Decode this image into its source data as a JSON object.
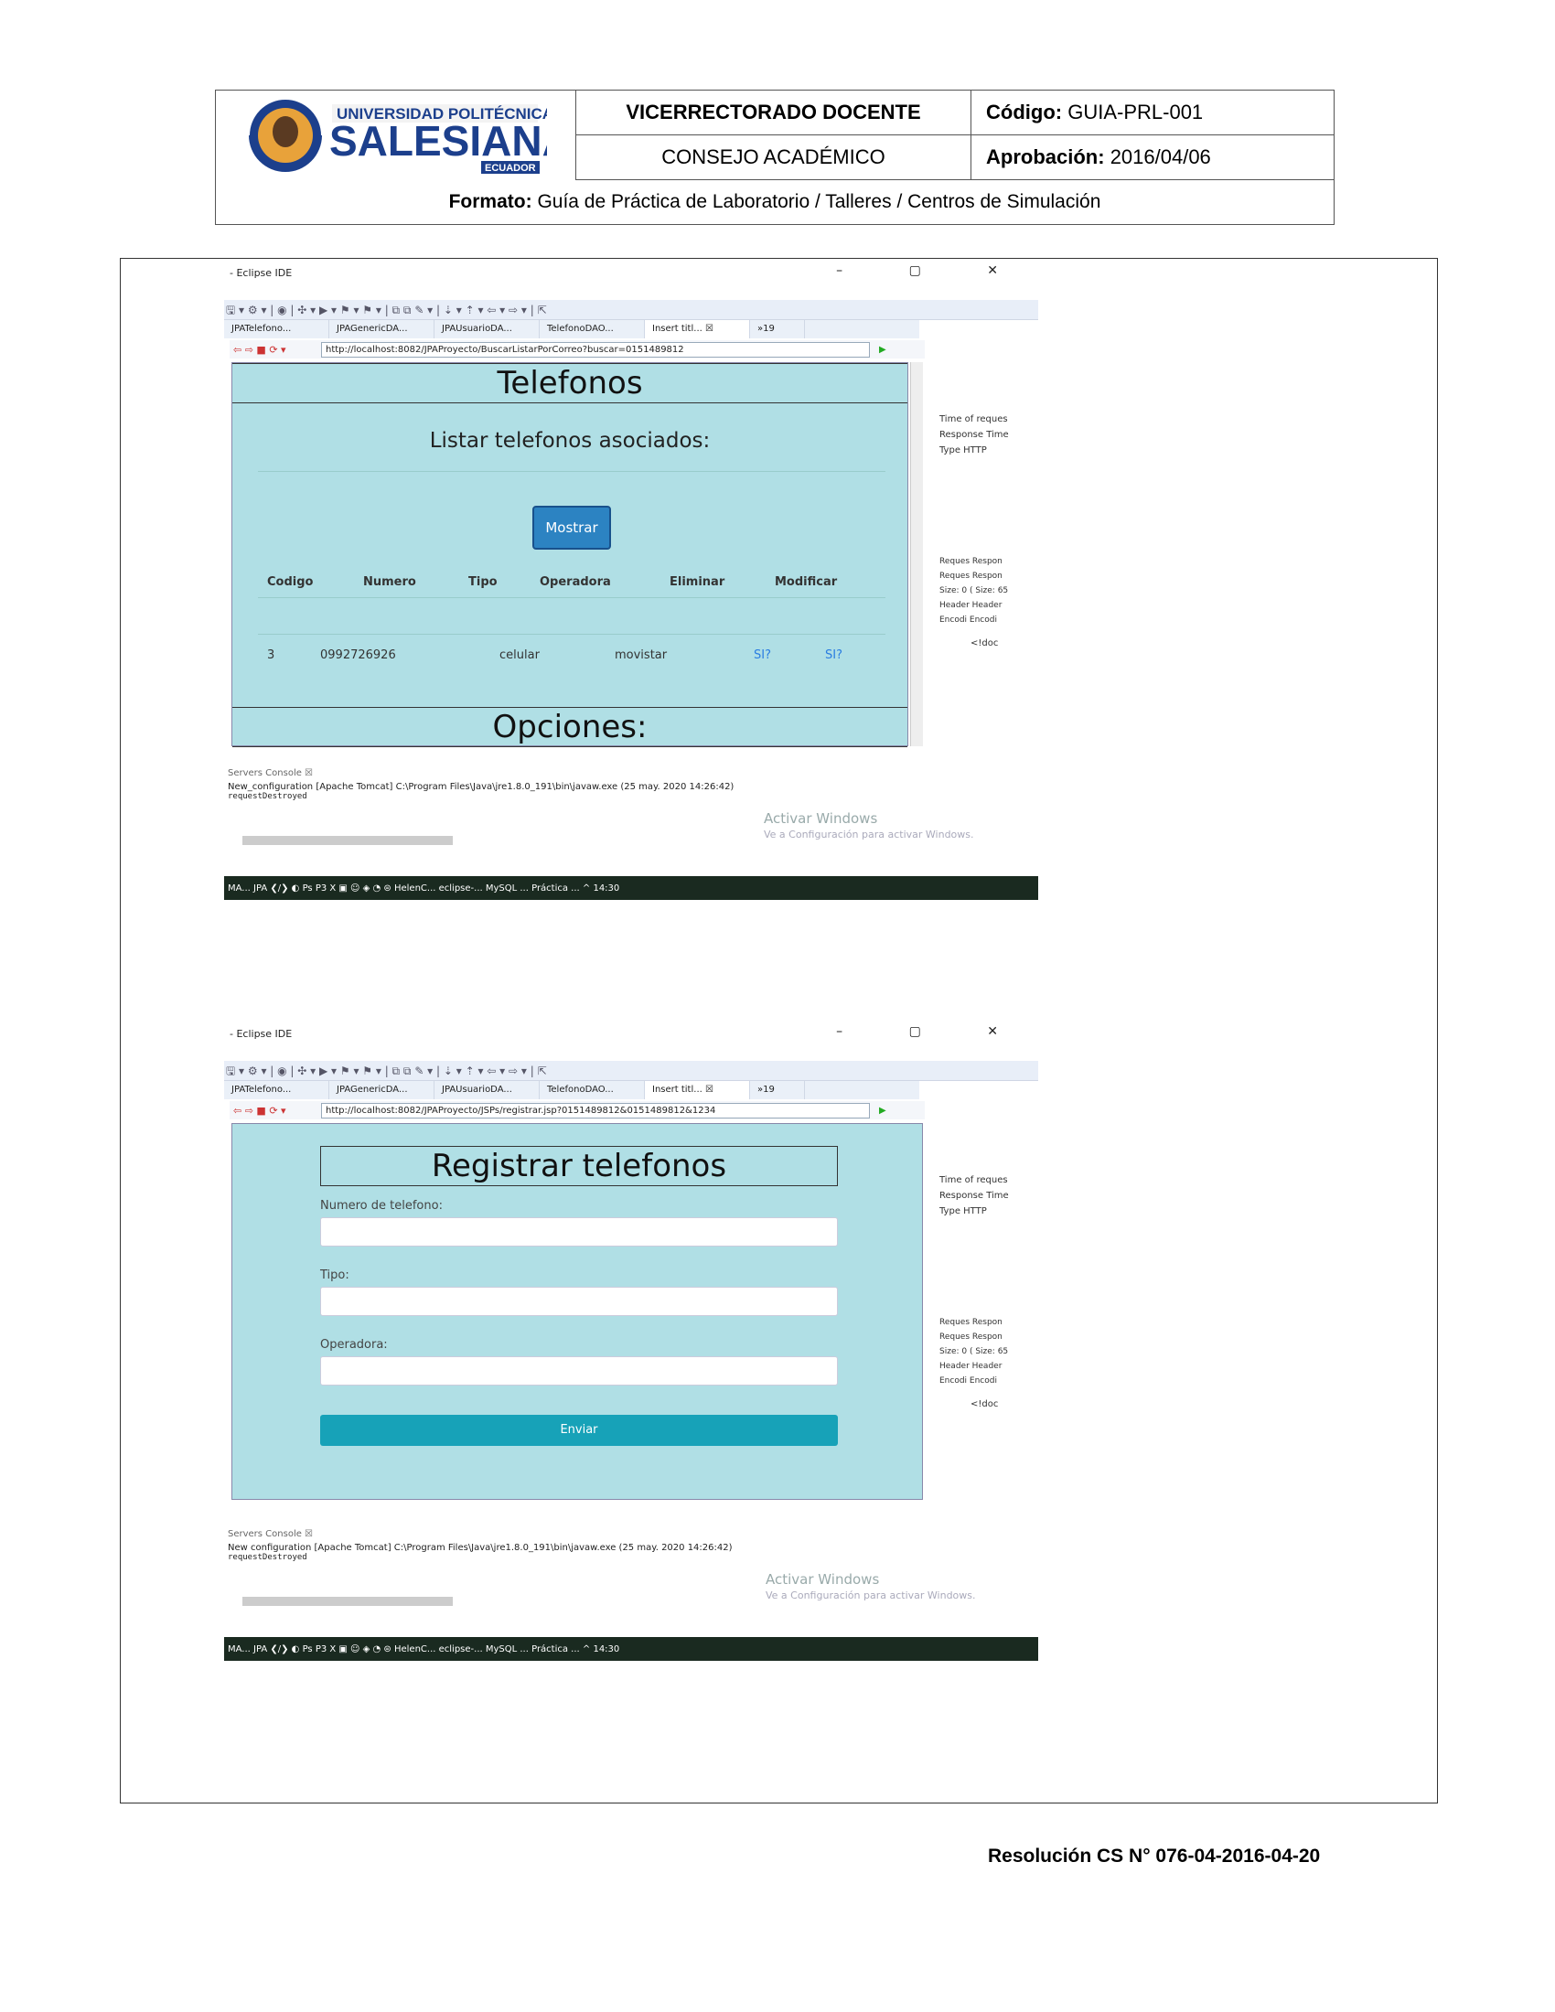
{
  "header": {
    "logo_line1": "UNIVERSIDAD POLITÉCNICA",
    "logo_line2": "SALESIANA",
    "logo_line3": "ECUADOR",
    "dept": "VICERRECTORADO DOCENTE",
    "code_label": "Código:",
    "code_value": "GUIA-PRL-001",
    "council": "CONSEJO ACADÉMICO",
    "approval_label": "Aprobación:",
    "approval_value": "2016/04/06",
    "format_label": "Formato:",
    "format_value": "Guía de Práctica de Laboratorio / Talleres / Centros de Simulación"
  },
  "footer": "Resolución CS N° 076-04-2016-04-20",
  "shot1": {
    "title": "- Eclipse IDE",
    "window_controls": "– ▢ ✕",
    "toolbar_icons": "🖫 ▾ ⚙ ▾ | ◉ | ✣ ▾ ▶ ▾ ⚑ ▾ ⚑ ▾ | ⧉ ⧉ ✎ ▾ | ⇣ ▾ ⇡ ▾ ⇦ ▾ ⇨ ▾ | ⇱",
    "tabs": [
      "JPATelefono...",
      "JPAGenericDA...",
      "JPAUsuarioDA...",
      "TelefonoDAO...",
      "Insert titl... ☒",
      "»19"
    ],
    "url": "http://localhost:8082/JPAProyecto/BuscarListarPorCorreo?buscar=0151489812",
    "page_title": "Telefonos",
    "subtitle": "Listar telefonos asociados:",
    "button": "Mostrar",
    "columns": [
      "Codigo",
      "Numero",
      "Tipo",
      "Operadora",
      "Eliminar",
      "Modificar"
    ],
    "row": {
      "codigo": "3",
      "numero": "0992726926",
      "tipo": "celular",
      "operadora": "movistar",
      "eliminar": "SI?",
      "modificar": "SI?"
    },
    "options_title": "Opciones:",
    "side": {
      "time_of_request": "Time of reques",
      "response_time": "Response Time",
      "type": "Type HTTP",
      "req1": "Reques Respon",
      "req2": "Reques Respon",
      "size": "Size: 0 ( Size: 65",
      "header": "Header Header",
      "encod": "Encodi Encodi",
      "doc": "<!doc"
    },
    "console_tabs": "Servers   Console ☒",
    "console_line1": "New_configuration [Apache Tomcat] C:\\Program Files\\Java\\jre1.8.0_191\\bin\\javaw.exe (25 may. 2020 14:26:42)",
    "console_line2": "requestDestroyed",
    "watermark1": "Activar Windows",
    "watermark2": "Ve a Configuración para activar Windows.",
    "taskbar": "MA...   JPA        ❮/❯  ◐  Ps  P3  X  ▣  ☺  ◈  ◔  ⊜  HelenC...   eclipse-...   MySQL ...   Práctica ...   ^  14:30"
  },
  "shot2": {
    "title": "- Eclipse IDE",
    "window_controls": "– ▢ ✕",
    "toolbar_icons": "🖫 ▾ ⚙ ▾ | ◉ | ✣ ▾ ▶ ▾ ⚑ ▾ ⚑ ▾ | ⧉ ⧉ ✎ ▾ | ⇣ ▾ ⇡ ▾ ⇦ ▾ ⇨ ▾ | ⇱",
    "tabs": [
      "JPATelefono...",
      "JPAGenericDA...",
      "JPAUsuarioDA...",
      "TelefonoDAO...",
      "Insert titl... ☒",
      "»19"
    ],
    "url": "http://localhost:8082/JPAProyecto/JSPs/registrar.jsp?0151489812&0151489812&1234",
    "page_title": "Registrar telefonos",
    "label_numero": "Numero de telefono:",
    "label_tipo": "Tipo:",
    "label_operadora": "Operadora:",
    "button": "Enviar",
    "side": {
      "time_of_request": "Time of reques",
      "response_time": "Response Time",
      "type": "Type HTTP",
      "req1": "Reques Respon",
      "req2": "Reques Respon",
      "size": "Size: 0 ( Size: 65",
      "header": "Header Header",
      "encod": "Encodi Encodi",
      "doc": "<!doc"
    },
    "console_tabs": "Servers   Console ☒",
    "console_line1": "New configuration [Apache Tomcat] C:\\Program Files\\Java\\jre1.8.0_191\\bin\\javaw.exe (25 may. 2020 14:26:42)",
    "console_line2": "requestDestroyed",
    "watermark1": "Activar Windows",
    "watermark2": "Ve a Configuración para activar Windows.",
    "taskbar": "MA...   JPA        ❮/❯  ◐  Ps  P3  X  ▣  ☺  ◈  ◔  ⊜  HelenC...   eclipse-...   MySQL ...   Práctica ...   ^  14:30"
  }
}
